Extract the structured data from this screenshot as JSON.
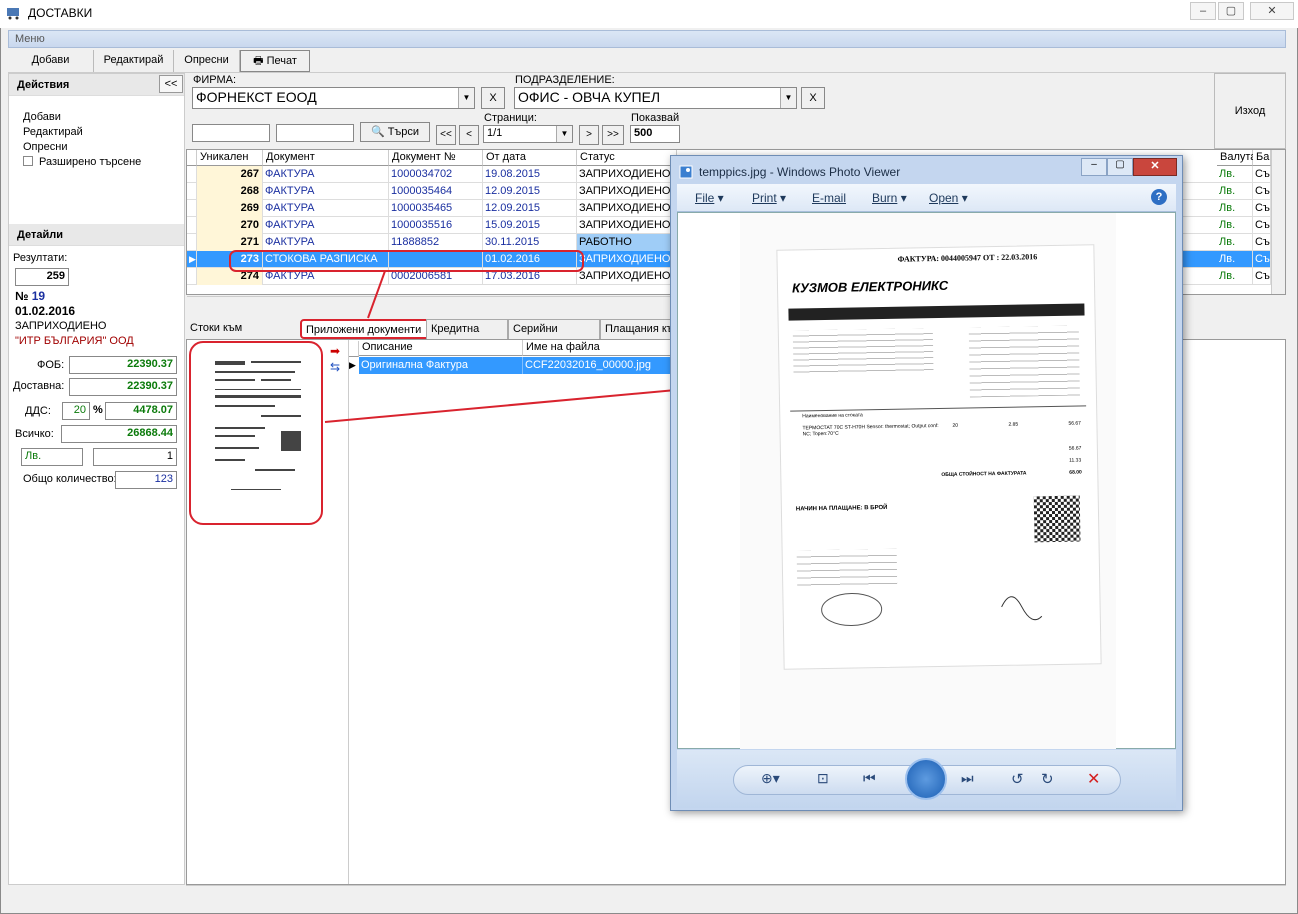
{
  "window": {
    "title": "ДОСТАВКИ",
    "menu": "Меню"
  },
  "toolbar": {
    "add": "Добави",
    "edit": "Редактирай",
    "refresh": "Опресни",
    "print": "Печат"
  },
  "actions": {
    "header": "Действия",
    "collapse": "<<",
    "add": "Добави",
    "edit": "Редактирай",
    "refresh": "Опресни",
    "extended": "Разширено търсене"
  },
  "details": {
    "header": "Детайли",
    "results_label": "Резултати:",
    "results": "259",
    "num_prefix": "№",
    "num": "19",
    "date": "01.02.2016",
    "status": "ЗАПРИХОДИЕНО",
    "company": "\"ИТР БЪЛГАРИЯ\" ООД",
    "fob_label": "ФОБ:",
    "fob": "22390.37",
    "delivery_label": "Доставна:",
    "delivery": "22390.37",
    "vat_label": "ДДС:",
    "vat_pct": "20",
    "pct": "%",
    "vat": "4478.07",
    "total_label": "Всичко:",
    "total": "26868.44",
    "currency": "Лв.",
    "rate": "1",
    "qty_label": "Общо количество:",
    "qty": "123"
  },
  "filter": {
    "firm_label": "ФИРМА:",
    "firm": "ФОРНЕКСТ ЕООД",
    "dept_label": "ПОДРАЗДЕЛЕНИЕ:",
    "dept": "ОФИС - ОВЧА КУПЕЛ",
    "x": "X",
    "search": "Търси",
    "first": "<<",
    "prev": "<",
    "next": ">",
    "last": ">>",
    "pages_label": "Страници:",
    "pages": "1/1",
    "show_label": "Показвай",
    "show": "500",
    "exit": "Изход"
  },
  "grid": {
    "headers": [
      "Уникален №",
      "Документ",
      "Документ №",
      "От дата",
      "Статус"
    ],
    "right_headers": [
      "Валута",
      "Ба"
    ],
    "rows": [
      {
        "id": "267",
        "doc": "ФАКТУРА",
        "num": "1000034702",
        "date": "19.08.2015",
        "status": "ЗАПРИХОДИЕНО",
        "cur": "Лв.",
        "b": "Съ"
      },
      {
        "id": "268",
        "doc": "ФАКТУРА",
        "num": "1000035464",
        "date": "12.09.2015",
        "status": "ЗАПРИХОДИЕНО",
        "cur": "Лв.",
        "b": "Съ"
      },
      {
        "id": "269",
        "doc": "ФАКТУРА",
        "num": "1000035465",
        "date": "12.09.2015",
        "status": "ЗАПРИХОДИЕНО",
        "cur": "Лв.",
        "b": "Съ"
      },
      {
        "id": "270",
        "doc": "ФАКТУРА",
        "num": "1000035516",
        "date": "15.09.2015",
        "status": "ЗАПРИХОДИЕНО",
        "cur": "Лв.",
        "b": "Съ"
      },
      {
        "id": "271",
        "doc": "ФАКТУРА",
        "num": "11888852",
        "date": "30.11.2015",
        "status": "РАБОТНО",
        "cur": "Лв.",
        "b": "Съ"
      },
      {
        "id": "273",
        "doc": "СТОКОВА РАЗПИСКА",
        "num": "",
        "date": "01.02.2016",
        "status": "ЗАПРИХОДИЕНО",
        "cur": "Лв.",
        "b": "Съ"
      },
      {
        "id": "274",
        "doc": "ФАКТУРА",
        "num": "0002006581",
        "date": "17.03.2016",
        "status": "ЗАПРИХОДИЕНО",
        "cur": "Лв.",
        "b": "Съ"
      }
    ]
  },
  "tabs": [
    "Стоки към документа",
    "Приложени документи",
    "Кредитна нота",
    "Серийни номера",
    "Плащания къ"
  ],
  "attachments": {
    "headers": [
      "Описание",
      "Име на файла"
    ],
    "rows": [
      {
        "desc": "Оригинална Фактура",
        "file": "CCF22032016_00000.jpg"
      }
    ]
  },
  "photoviewer": {
    "title": "temppics.jpg - Windows Photo Viewer",
    "menu": [
      "File",
      "Print",
      "E-mail",
      "Burn",
      "Open"
    ],
    "help": "?"
  },
  "invoice": {
    "header": "ФАКТУРА: 0044005947 ОТ : 22.03.2016",
    "brand": "КУЗМОВ ЕЛЕКТРОНИКС",
    "items_label": "Наименование на стоката",
    "item": "ТЕРМОСТАТ 70С ST-H70H Sensor: thermostat; Output conf: NC; Topen:70°C",
    "qty": "20",
    "price": "2.85",
    "amount": "56.67",
    "base": "56.67",
    "vat": "11.33",
    "total": "68.00",
    "pay": "НАЧИН НА ПЛАЩАНЕ: В БРОЙ",
    "total_label": "ОБЩА СТОЙНОСТ НА ФАКТУРАТА"
  }
}
